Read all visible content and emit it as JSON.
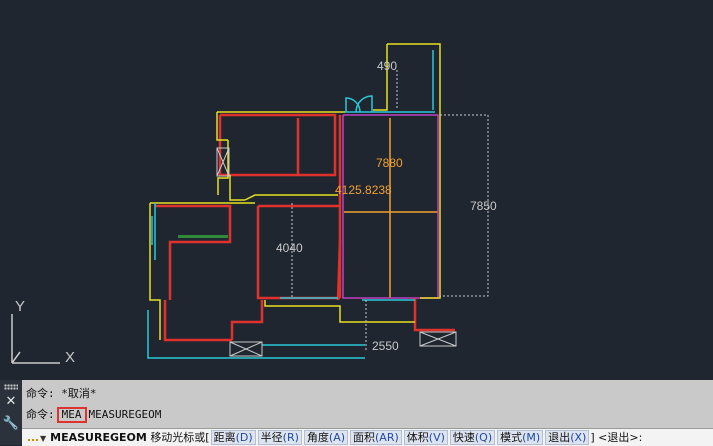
{
  "dimensions": {
    "top_width": "490",
    "area_height": "7880",
    "area_measure": "4125.8238",
    "right_height": "7850",
    "middle_height": "4040",
    "bottom_width": "2550"
  },
  "ucs": {
    "y_label": "Y",
    "x_label": "X"
  },
  "command_history": {
    "line1_prefix": "命令:",
    "line1_text": "*取消*",
    "line2_prefix": "命令:",
    "line2_highlight": "MEA",
    "line2_text": "MEASUREGEOM"
  },
  "prompt": {
    "command": "MEASUREGEOM",
    "instruction": "移动光标或[",
    "options": [
      {
        "label": "距离",
        "key": "(D)"
      },
      {
        "label": "半径",
        "key": "(R)"
      },
      {
        "label": "角度",
        "key": "(A)"
      },
      {
        "label": "面积",
        "key": "(AR)"
      },
      {
        "label": "体积",
        "key": "(V)"
      },
      {
        "label": "快速",
        "key": "(Q)"
      },
      {
        "label": "模式",
        "key": "(M)"
      },
      {
        "label": "退出",
        "key": "(X)"
      }
    ],
    "suffix": "] <退出>:"
  },
  "icons": {
    "close": "close-icon",
    "settings": "wrench-icon",
    "grip": "grip-icon"
  },
  "colors": {
    "background": "#1f2630",
    "wall_red": "#e0322c",
    "wall_yellow": "#e6e021",
    "wall_cyan": "#28c8d8",
    "dim_orange": "#f0a030"
  }
}
